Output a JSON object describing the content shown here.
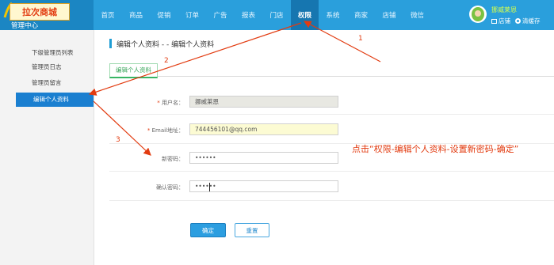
{
  "app": {
    "logo_text": "拉次商城",
    "section_title": "管理中心"
  },
  "nav": {
    "items": [
      "首页",
      "商品",
      "促销",
      "订单",
      "广告",
      "报表",
      "门店",
      "权限",
      "系统",
      "商家",
      "店铺",
      "微信"
    ],
    "active": "权限"
  },
  "user": {
    "name": "挪威莱恩",
    "store_link": "店铺",
    "cache_link": "清缓存"
  },
  "sidebar": {
    "items": [
      {
        "label": "下级管理员列表"
      },
      {
        "label": "管理员日志"
      },
      {
        "label": "管理员留言"
      },
      {
        "label": "编辑个人资料"
      }
    ]
  },
  "main": {
    "page_title": "编辑个人资料 - - 编辑个人资料",
    "tab": "编辑个人资料",
    "form": {
      "username_label": "用户名：",
      "username_value": "挪威莱恩",
      "email_label": "Email地址：",
      "email_value": "744456101@qq.com",
      "new_password_label": "新密码：",
      "new_password_value": "••••••",
      "confirm_password_label": "确认密码：",
      "confirm_password_value": "••••••",
      "submit_label": "确定",
      "reset_label": "重置"
    }
  },
  "annotations": {
    "instruction": "点击“权限-编辑个人资料-设置新密码-确定”",
    "step1": "1",
    "step2": "2",
    "step3": "3",
    "color": "#e23b10"
  },
  "colors": {
    "topbar": "#2a9fdc",
    "active_nav": "#1676b0",
    "sidebar_active": "#1a7fd0",
    "primary_button": "#2c9ee0"
  }
}
